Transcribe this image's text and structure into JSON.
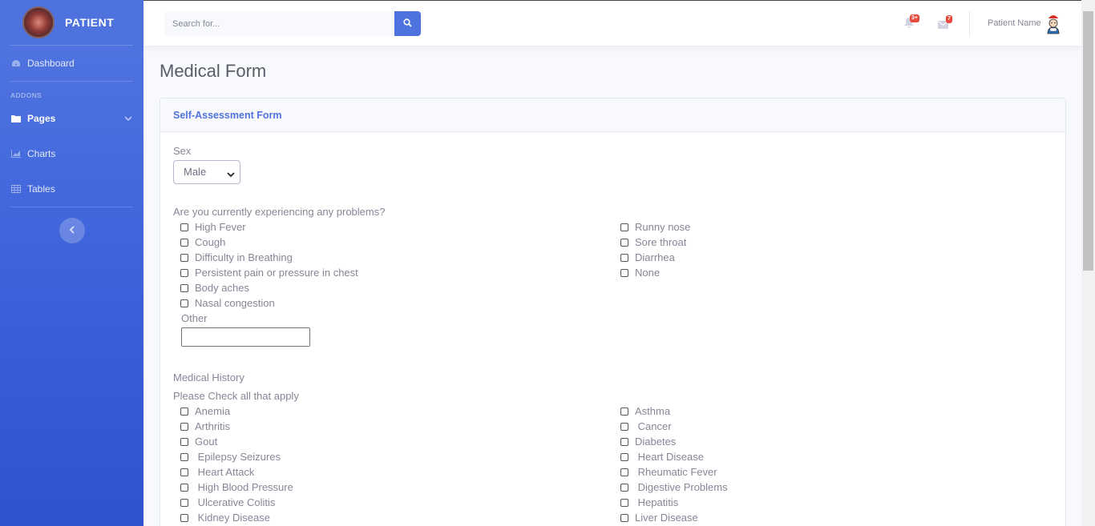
{
  "brand": {
    "title": "PATIENT"
  },
  "sidebar": {
    "dashboard": "Dashboard",
    "heading": "ADDONS",
    "pages": "Pages",
    "charts": "Charts",
    "tables": "Tables"
  },
  "topbar": {
    "search_placeholder": "Search for...",
    "alerts_badge": "3+",
    "messages_badge": "7",
    "user_name": "Patient Name"
  },
  "page": {
    "title": "Medical Form"
  },
  "form": {
    "header": "Self-Assessment Form",
    "sex_label": "Sex",
    "sex_value": "Male",
    "problems_label": "Are you currently experiencing any problems?",
    "problems_left": [
      "High Fever",
      "Cough",
      "Difficulty in Breathing",
      "Persistent pain or pressure in chest",
      "Body aches",
      "Nasal congestion"
    ],
    "problems_right": [
      "Runny nose",
      "Sore throat",
      "Diarrhea",
      "None"
    ],
    "other_label": "Other",
    "history_label": "Medical History",
    "history_sub": "Please Check all that apply",
    "history_left": [
      "Anemia",
      "Arthritis",
      "Gout",
      " Epilepsy Seizures",
      " Heart Attack",
      " High Blood Pressure",
      " Ulcerative Colitis",
      " Kidney Disease"
    ],
    "history_right": [
      "Asthma",
      " Cancer",
      "Diabetes",
      " Heart Disease",
      " Rheumatic Fever",
      " Digestive Problems",
      " Hepatitis",
      "Liver Disease"
    ]
  },
  "colors": {
    "primary": "#4e73df",
    "badge": "#e74a3b",
    "text": "#858796"
  }
}
